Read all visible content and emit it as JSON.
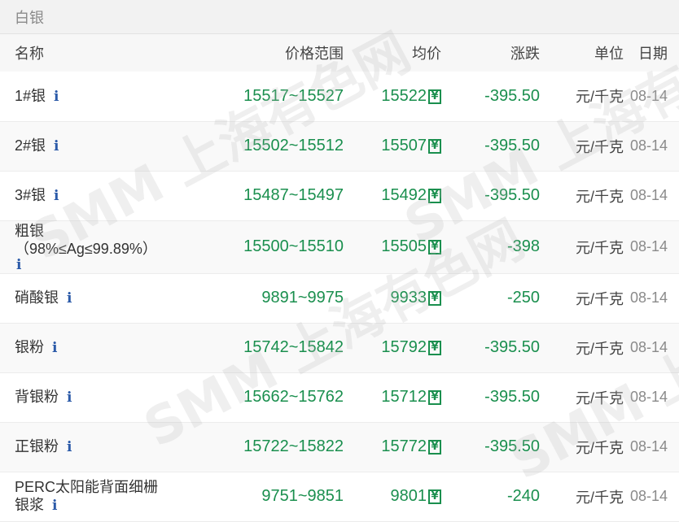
{
  "section": {
    "title": "白银"
  },
  "table": {
    "headers": {
      "name": "名称",
      "range": "价格范围",
      "avg": "均价",
      "change": "涨跌",
      "unit": "单位",
      "date": "日期"
    },
    "info_glyph": "i",
    "yen_glyph": "¥",
    "rows": [
      {
        "name": "1#银",
        "name2": "",
        "range": "15517~15527",
        "avg": "15522",
        "change": "-395.50",
        "unit": "元/千克",
        "date": "08-14"
      },
      {
        "name": "2#银",
        "name2": "",
        "range": "15502~15512",
        "avg": "15507",
        "change": "-395.50",
        "unit": "元/千克",
        "date": "08-14"
      },
      {
        "name": "3#银",
        "name2": "",
        "range": "15487~15497",
        "avg": "15492",
        "change": "-395.50",
        "unit": "元/千克",
        "date": "08-14"
      },
      {
        "name": "粗银",
        "name2": "（98%≤Ag≤99.89%）",
        "range": "15500~15510",
        "avg": "15505",
        "change": "-398",
        "unit": "元/千克",
        "date": "08-14"
      },
      {
        "name": "硝酸银",
        "name2": "",
        "range": "9891~9975",
        "avg": "9933",
        "change": "-250",
        "unit": "元/千克",
        "date": "08-14"
      },
      {
        "name": "银粉",
        "name2": "",
        "range": "15742~15842",
        "avg": "15792",
        "change": "-395.50",
        "unit": "元/千克",
        "date": "08-14"
      },
      {
        "name": "背银粉",
        "name2": "",
        "range": "15662~15762",
        "avg": "15712",
        "change": "-395.50",
        "unit": "元/千克",
        "date": "08-14"
      },
      {
        "name": "正银粉",
        "name2": "",
        "range": "15722~15822",
        "avg": "15772",
        "change": "-395.50",
        "unit": "元/千克",
        "date": "08-14"
      },
      {
        "name": "PERC太阳能背面细栅",
        "name2": "银浆",
        "range": "9751~9851",
        "avg": "9801",
        "change": "-240",
        "unit": "元/千克",
        "date": "08-14"
      }
    ]
  },
  "watermark": {
    "text": "SMM 上海有色网"
  },
  "colors": {
    "price_green": "#1a8f4e",
    "info_blue": "#2b5aa8",
    "header_bg": "#f2f2f2"
  }
}
